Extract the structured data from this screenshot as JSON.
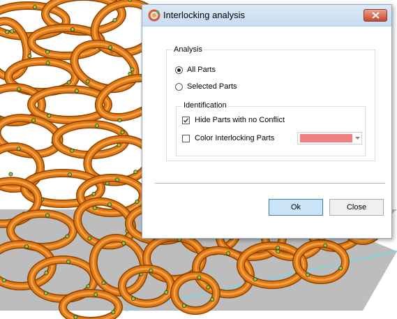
{
  "dialog": {
    "title": "Interlocking analysis",
    "analysis_label": "Analysis",
    "all_parts_label": "All Parts",
    "all_parts_selected": true,
    "selected_parts_label": "Selected Parts",
    "selected_parts_selected": false,
    "identification_label": "Identification",
    "hide_parts_label": "Hide Parts with no Conflict",
    "hide_parts_checked": true,
    "color_parts_label": "Color Interlocking Parts",
    "color_parts_checked": false,
    "color_value": "#f08080",
    "ok_label": "Ok",
    "close_label": "Close"
  },
  "theme": {
    "ring_color": "#e07810",
    "ring_dark": "#8a4200",
    "ring_light": "#f4a04a",
    "marker_color": "#9ac43c",
    "floor_color": "#bdbdbd"
  }
}
